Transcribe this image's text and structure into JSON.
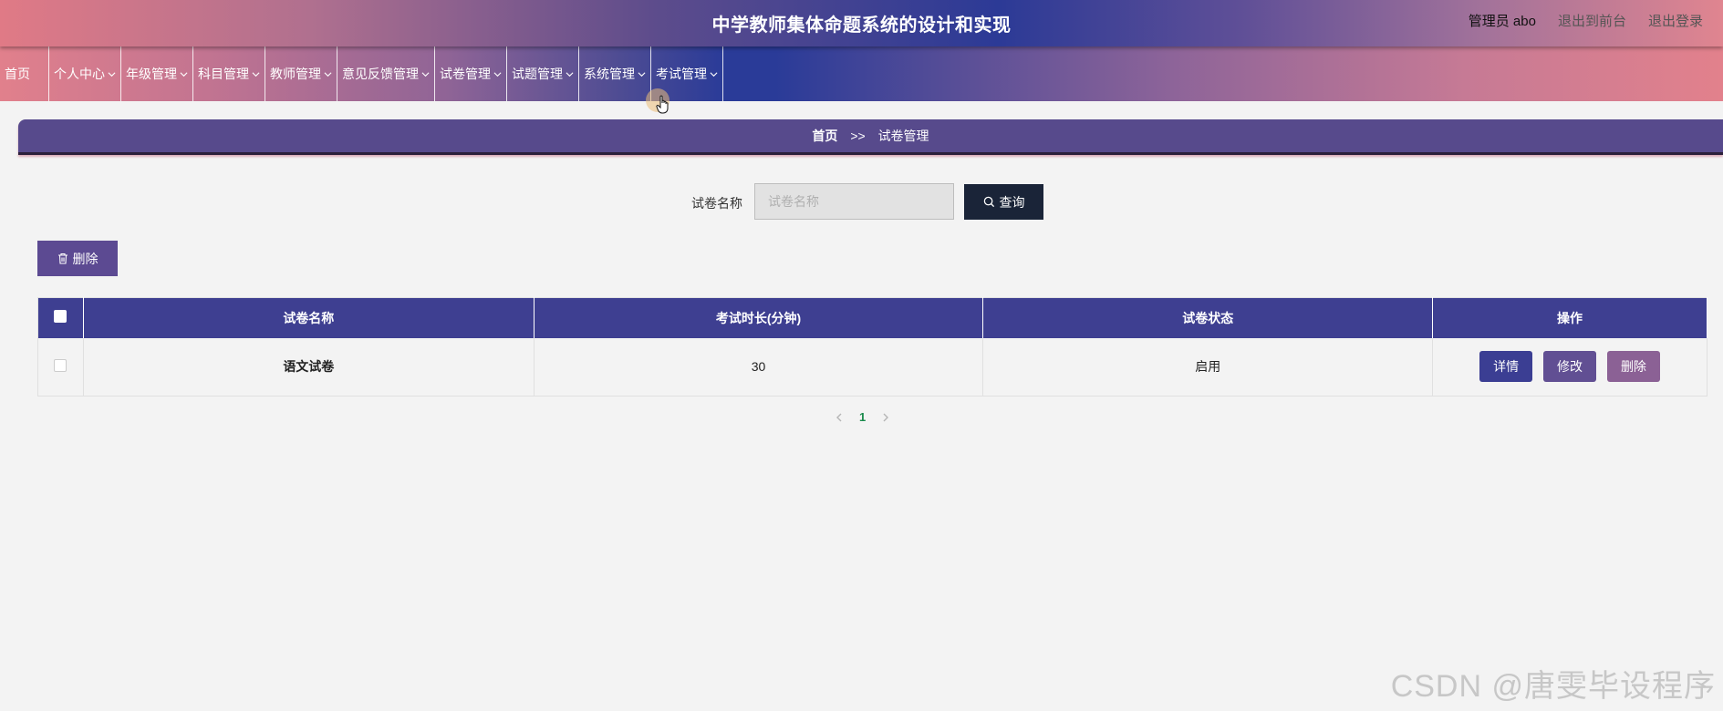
{
  "header": {
    "title": "中学教师集体命题系统的设计和实现",
    "user_label": "管理员 abo",
    "link_front": "退出到前台",
    "link_logout": "退出登录"
  },
  "nav": {
    "home": "首页",
    "items": [
      "个人中心",
      "年级管理",
      "科目管理",
      "教师管理",
      "意见反馈管理",
      "试卷管理",
      "试题管理",
      "系统管理",
      "考试管理"
    ]
  },
  "breadcrumb": {
    "home": "首页",
    "separator": ">>",
    "current": "试卷管理"
  },
  "search": {
    "label": "试卷名称",
    "placeholder": "试卷名称",
    "button": "查询"
  },
  "toolbar": {
    "delete_label": "删除"
  },
  "table": {
    "headers": [
      "试卷名称",
      "考试时长(分钟)",
      "试卷状态",
      "操作"
    ],
    "rows": [
      {
        "name": "语文试卷",
        "duration": "30",
        "status": "启用"
      }
    ],
    "actions": {
      "detail": "详情",
      "edit": "修改",
      "delete": "删除"
    }
  },
  "pagination": {
    "current": "1",
    "prev_icon": "chevron-left-icon",
    "next_icon": "chevron-right-icon"
  },
  "watermark": "CSDN @唐雯毕设程序",
  "colors": {
    "table_header": "#3e3f91",
    "detail_button": "#3b3e93",
    "edit_button": "#614f93",
    "delete_button": "#8b6195",
    "search_button": "#1a2438",
    "page_active": "#1a8a4c"
  }
}
